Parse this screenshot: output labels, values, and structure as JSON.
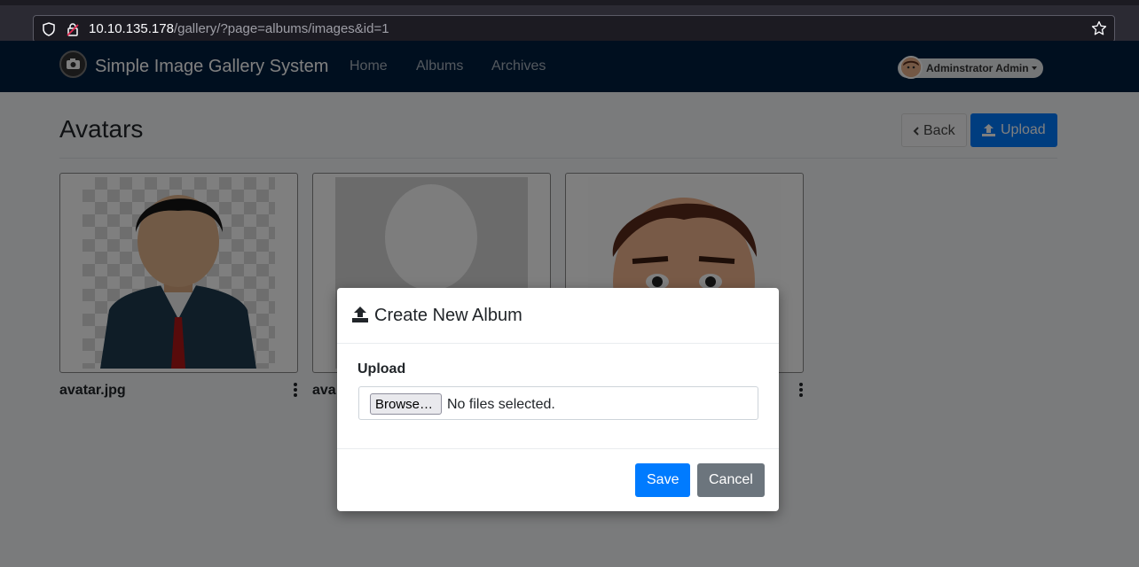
{
  "browser": {
    "url_host": "10.10.135.178",
    "url_path": "/gallery/?page=albums/images&id=1"
  },
  "navbar": {
    "brand": "Simple Image Gallery System",
    "links": [
      "Home",
      "Albums",
      "Archives"
    ],
    "user": "Adminstrator Admin"
  },
  "page": {
    "title": "Avatars",
    "back_label": "Back",
    "upload_label": "Upload"
  },
  "images": [
    {
      "name": "avatar.jpg"
    },
    {
      "name": "ava"
    },
    {
      "name": ""
    }
  ],
  "modal": {
    "title": "Create New Album",
    "field_label": "Upload",
    "browse_label": "Browse…",
    "file_status": "No files selected.",
    "save_label": "Save",
    "cancel_label": "Cancel"
  }
}
